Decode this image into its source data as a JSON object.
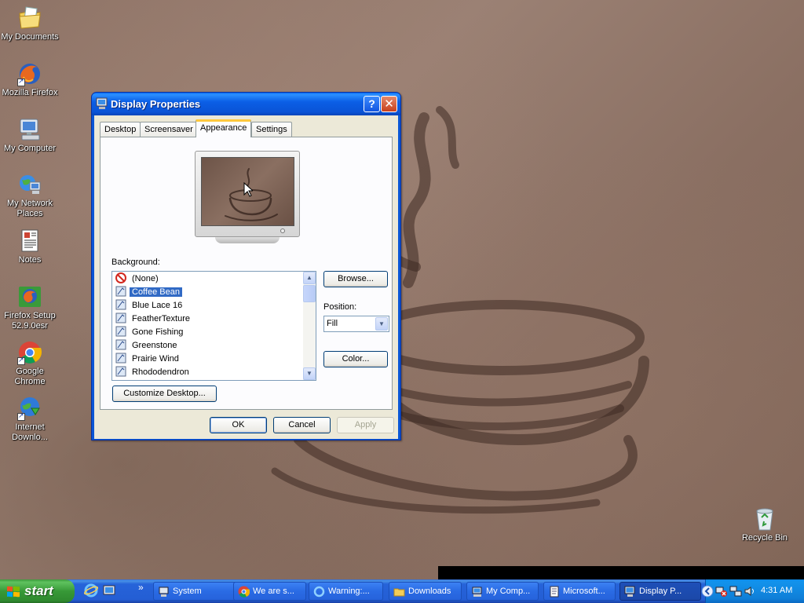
{
  "desktop": {
    "wallpaper_name": "Coffee Bean",
    "icons": [
      {
        "label": "My Documents",
        "icon": "my-documents-icon"
      },
      {
        "label": "Mozilla Firefox",
        "icon": "firefox-icon"
      },
      {
        "label": "My Computer",
        "icon": "my-computer-icon"
      },
      {
        "label": "My Network Places",
        "icon": "network-places-icon"
      },
      {
        "label": "Notes",
        "icon": "notes-icon"
      },
      {
        "label": "Firefox Setup 52.9.0esr",
        "icon": "firefox-setup-icon"
      },
      {
        "label": "Google Chrome",
        "icon": "chrome-icon"
      },
      {
        "label": "Internet Downlo...",
        "icon": "internet-download-manager-icon"
      },
      {
        "label": "Recycle Bin",
        "icon": "recycle-bin-icon"
      }
    ]
  },
  "dialog": {
    "title": "Display Properties",
    "help_button": "?",
    "close_button": "✕",
    "tabs": [
      "Desktop",
      "Screensaver",
      "Appearance",
      "Settings"
    ],
    "active_tab": "Appearance",
    "background_label": "Background:",
    "backgrounds": [
      {
        "label": "(None)",
        "icon": "none-icon"
      },
      {
        "label": "Coffee Bean",
        "icon": "bitmap-icon",
        "selected": true
      },
      {
        "label": "Blue Lace 16",
        "icon": "bitmap-icon"
      },
      {
        "label": "FeatherTexture",
        "icon": "bitmap-icon"
      },
      {
        "label": "Gone Fishing",
        "icon": "bitmap-icon"
      },
      {
        "label": "Greenstone",
        "icon": "bitmap-icon"
      },
      {
        "label": "Prairie Wind",
        "icon": "bitmap-icon"
      },
      {
        "label": "Rhododendron",
        "icon": "bitmap-icon"
      }
    ],
    "browse_button": "Browse...",
    "position_label": "Position:",
    "position_value": "Fill",
    "color_button": "Color...",
    "customize_button": "Customize Desktop...",
    "ok_button": "OK",
    "cancel_button": "Cancel",
    "apply_button": "Apply"
  },
  "taskbar": {
    "start_label": "start",
    "quick_launch": [
      "internet-explorer-icon",
      "show-desktop-icon"
    ],
    "quick_launch_more": "»",
    "tasks": [
      {
        "label": "System",
        "icon": "system-icon"
      },
      {
        "label": "We are s...",
        "icon": "chrome-icon"
      },
      {
        "label": "Warning:...",
        "icon": "internet-explorer-icon"
      },
      {
        "label": "Downloads",
        "icon": "folder-icon"
      },
      {
        "label": "My Comp...",
        "icon": "my-computer-icon"
      },
      {
        "label": "Microsoft...",
        "icon": "notepad-icon"
      },
      {
        "label": "Display P...",
        "icon": "display-properties-icon",
        "active": true
      }
    ],
    "clock": "4:31 AM"
  },
  "colors": {
    "selection": "#316ac5",
    "xp_blue": "#245ed4",
    "start_green": "#379937",
    "dialog_face": "#ece9d8"
  }
}
